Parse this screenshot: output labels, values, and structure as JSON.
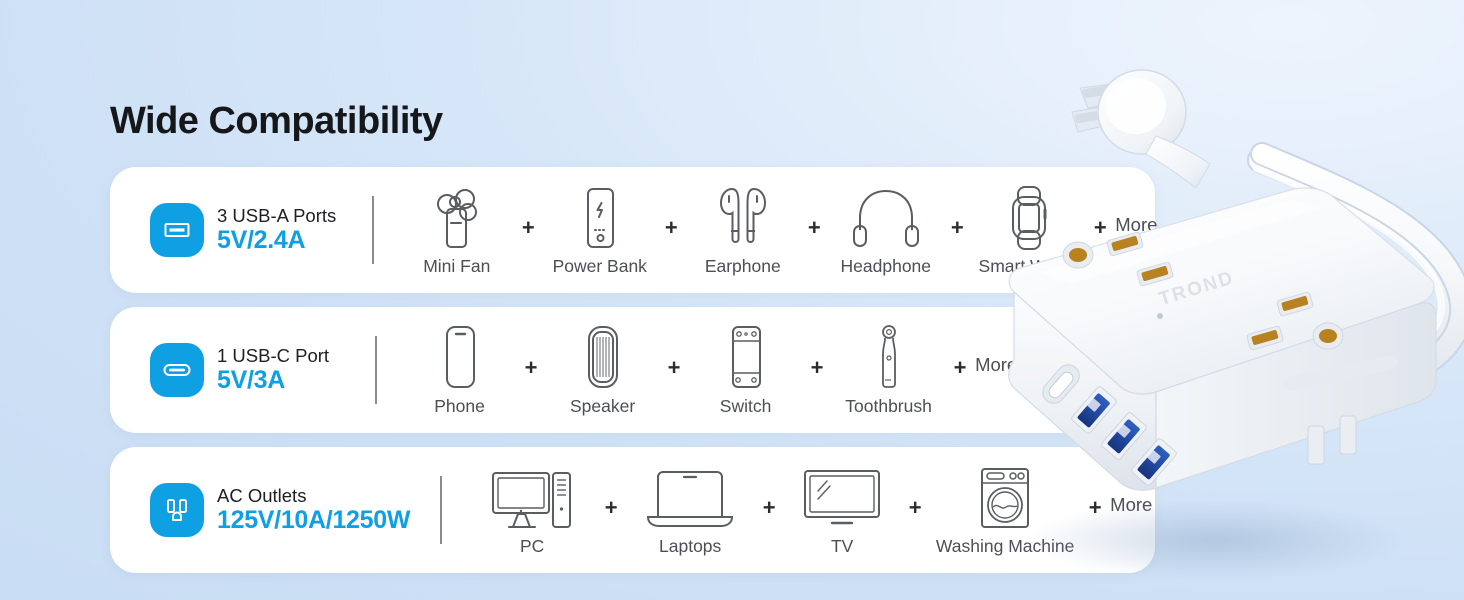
{
  "page": {
    "title": "Wide Compatibility",
    "brand": "TROND",
    "accent_color": "#0f9fe3",
    "title_color": "#15171a",
    "background_colors": [
      "#c6dcf3",
      "#e8f0fc"
    ],
    "card_background": "#ffffff",
    "plus_symbol": "+",
    "more_label": "More"
  },
  "rows": [
    {
      "spec_name": "3 USB-A Ports",
      "spec_value": "5V/2.4A",
      "icon": "usb-a-port-icon",
      "devices": [
        {
          "label": "Mini Fan",
          "icon": "mini-fan-icon"
        },
        {
          "label": "Power Bank",
          "icon": "power-bank-icon"
        },
        {
          "label": "Earphone",
          "icon": "earphone-icon"
        },
        {
          "label": "Headphone",
          "icon": "headphone-icon"
        },
        {
          "label": "Smart Watch",
          "icon": "smart-watch-icon"
        }
      ]
    },
    {
      "spec_name": "1 USB-C Port",
      "spec_value": "5V/3A",
      "icon": "usb-c-port-icon",
      "devices": [
        {
          "label": "Phone",
          "icon": "phone-icon"
        },
        {
          "label": "Speaker",
          "icon": "speaker-icon"
        },
        {
          "label": "Switch",
          "icon": "game-console-icon"
        },
        {
          "label": "Toothbrush",
          "icon": "electric-toothbrush-icon"
        }
      ]
    },
    {
      "spec_name": "AC Outlets",
      "spec_value": "125V/10A/1250W",
      "icon": "ac-outlet-icon",
      "devices": [
        {
          "label": "PC",
          "icon": "desktop-pc-icon"
        },
        {
          "label": "Laptops",
          "icon": "laptop-icon"
        },
        {
          "label": "TV",
          "icon": "tv-icon"
        },
        {
          "label": "Washing Machine",
          "icon": "washing-machine-icon"
        }
      ]
    }
  ],
  "product_image": {
    "name": "power-strip-photo",
    "description": "White power strip with flat wall plug and coiled cord",
    "usb_c_ports": 1,
    "usb_a_ports": 3
  }
}
